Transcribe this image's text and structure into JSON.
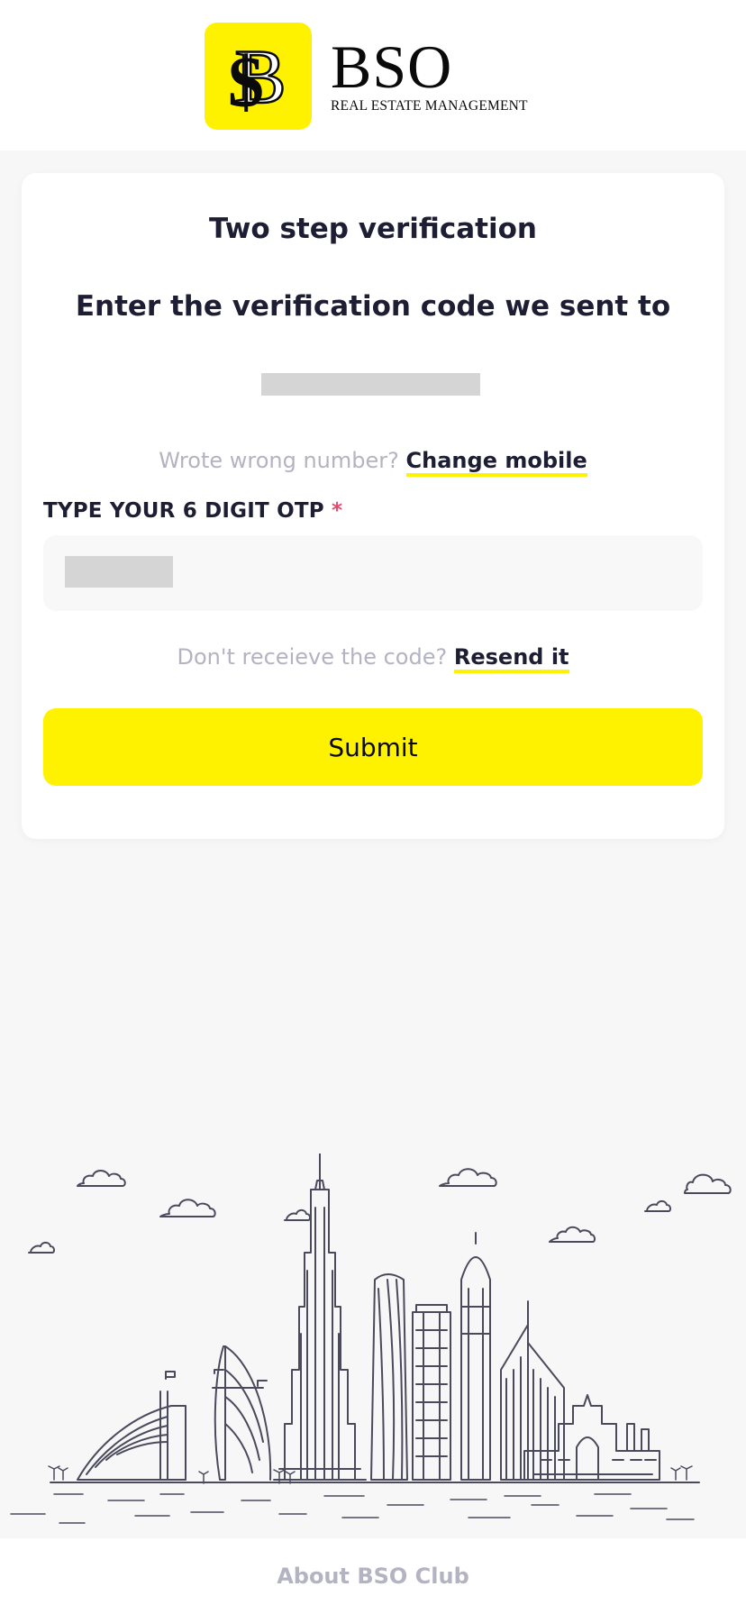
{
  "brand": {
    "name": "BSO",
    "tagline": "REAL ESTATE MANAGEMENT",
    "accent": "#fff200"
  },
  "verification": {
    "title": "Two step verification",
    "subtitle": "Enter the verification code we sent to",
    "wrong_number_prompt": "Wrote wrong number?",
    "change_mobile_label": "Change mobile",
    "otp_label": "TYPE YOUR 6 DIGIT OTP",
    "required_mark": "*",
    "resend_prompt": "Don't receieve the code?",
    "resend_label": "Resend it",
    "submit_label": "Submit"
  },
  "footer": {
    "about_label": "About BSO Club"
  }
}
